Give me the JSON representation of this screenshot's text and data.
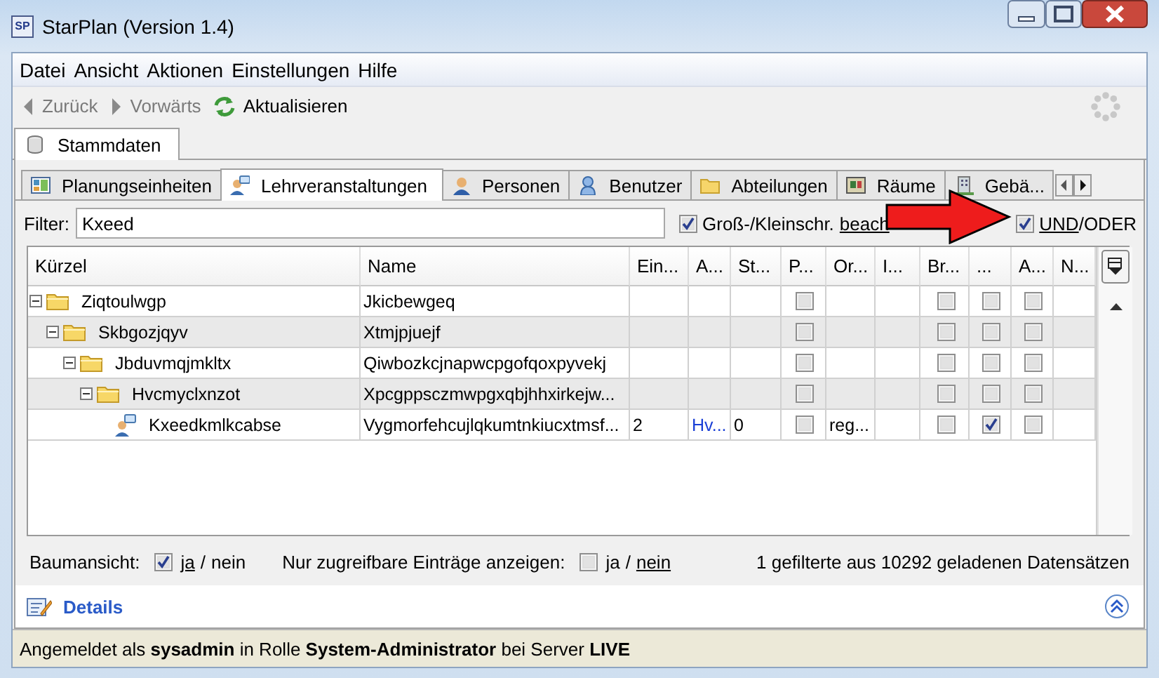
{
  "window": {
    "title": "StarPlan (Version 1.4)",
    "icon_text": "SP"
  },
  "menu": [
    {
      "label": "Datei"
    },
    {
      "label": "Ansicht"
    },
    {
      "label": "Aktionen"
    },
    {
      "label": "Einstellungen"
    },
    {
      "label": "Hilfe"
    }
  ],
  "toolbar": [
    {
      "label": "Zurück",
      "kind": "back",
      "disabled": true
    },
    {
      "label": "Vorwärts",
      "kind": "forward",
      "disabled": true
    },
    {
      "label": "Aktualisieren",
      "kind": "refresh",
      "disabled": false
    }
  ],
  "main_tabs": [
    {
      "label": "Stammdaten",
      "selected": true
    }
  ],
  "tabs": [
    {
      "label": "Planungseinheiten",
      "selected": false
    },
    {
      "label": "Lehrveranstaltungen",
      "selected": true
    },
    {
      "label": "Personen",
      "selected": false
    },
    {
      "label": "Benutzer",
      "selected": false
    },
    {
      "label": "Abteilungen",
      "selected": false
    },
    {
      "label": "Räume",
      "selected": false
    },
    {
      "label": "Gebä...",
      "selected": false
    }
  ],
  "filter": {
    "label": "Filter:",
    "value": "Kxeed",
    "case_sensitive": {
      "label": "Groß-/Kleinschr.",
      "link": "beach",
      "checked": true
    },
    "logic": {
      "checked": true,
      "separator": "/",
      "options": [
        {
          "label": "UND",
          "selected": true
        },
        {
          "label": "ODER",
          "selected": false
        }
      ]
    }
  },
  "table": {
    "columns": [
      {
        "label": "Kürzel",
        "kind": "tree"
      },
      {
        "label": "Name",
        "kind": "text"
      },
      {
        "label": "Ein...",
        "kind": "text"
      },
      {
        "label": "A...",
        "kind": "link"
      },
      {
        "label": "St...",
        "kind": "text"
      },
      {
        "label": "P...",
        "kind": "check"
      },
      {
        "label": "Or...",
        "kind": "text"
      },
      {
        "label": "I...",
        "kind": "text"
      },
      {
        "label": "Br...",
        "kind": "check"
      },
      {
        "label": "...",
        "kind": "check"
      },
      {
        "label": "A...",
        "kind": "check"
      },
      {
        "label": "N...",
        "kind": "text"
      }
    ],
    "rows": [
      {
        "kind": "folder",
        "expanded": true,
        "cells": [
          "Ziqtoulwgp",
          "Jkicbewgeq",
          null,
          null,
          null,
          false,
          null,
          null,
          false,
          false,
          false,
          null
        ],
        "children": [
          {
            "kind": "folder",
            "expanded": true,
            "cells": [
              "Skbgozjqyv",
              "Xtmjpjuejf",
              null,
              null,
              null,
              false,
              null,
              null,
              false,
              false,
              false,
              null
            ],
            "children": [
              {
                "kind": "folder",
                "expanded": true,
                "cells": [
                  "Jbduvmqjmkltx",
                  "Qiwbozkcjnapwcpgofqoxpyvekj",
                  null,
                  null,
                  null,
                  false,
                  null,
                  null,
                  false,
                  false,
                  false,
                  null
                ],
                "children": [
                  {
                    "kind": "folder",
                    "expanded": true,
                    "cells": [
                      "Hvcmyclxnzot",
                      "Xpcgppsczmwpgxqbjhhxirkejw...",
                      null,
                      null,
                      null,
                      false,
                      null,
                      null,
                      false,
                      false,
                      false,
                      null
                    ],
                    "children": [
                      {
                        "kind": "lecture",
                        "cells": [
                          "Kxeedkmlkcabse",
                          "Vygmorfehcujlqkumtnkiucxtmsf...",
                          "2",
                          "Hv...",
                          "0",
                          false,
                          "reg...",
                          null,
                          false,
                          true,
                          false,
                          null
                        ]
                      }
                    ]
                  }
                ]
              }
            ]
          }
        ]
      }
    ]
  },
  "footer": {
    "tree_view": {
      "label": "Baumansicht:",
      "checked": true,
      "separator": "/",
      "options": [
        {
          "label": "ja",
          "selected": true
        },
        {
          "label": "nein",
          "selected": false
        }
      ]
    },
    "accessible_only": {
      "label": "Nur zugreifbare Einträge anzeigen:",
      "checked": false,
      "separator": "/",
      "options": [
        {
          "label": "ja",
          "selected": false
        },
        {
          "label": "nein",
          "selected": true
        }
      ]
    },
    "count": "1 gefilterte aus 10292 geladenen Datensätzen"
  },
  "details": {
    "title": "Details",
    "expanded": false
  },
  "status_bar": "Angemeldet als **sysadmin** in Rolle **System-Administrator** bei Server **LIVE**"
}
